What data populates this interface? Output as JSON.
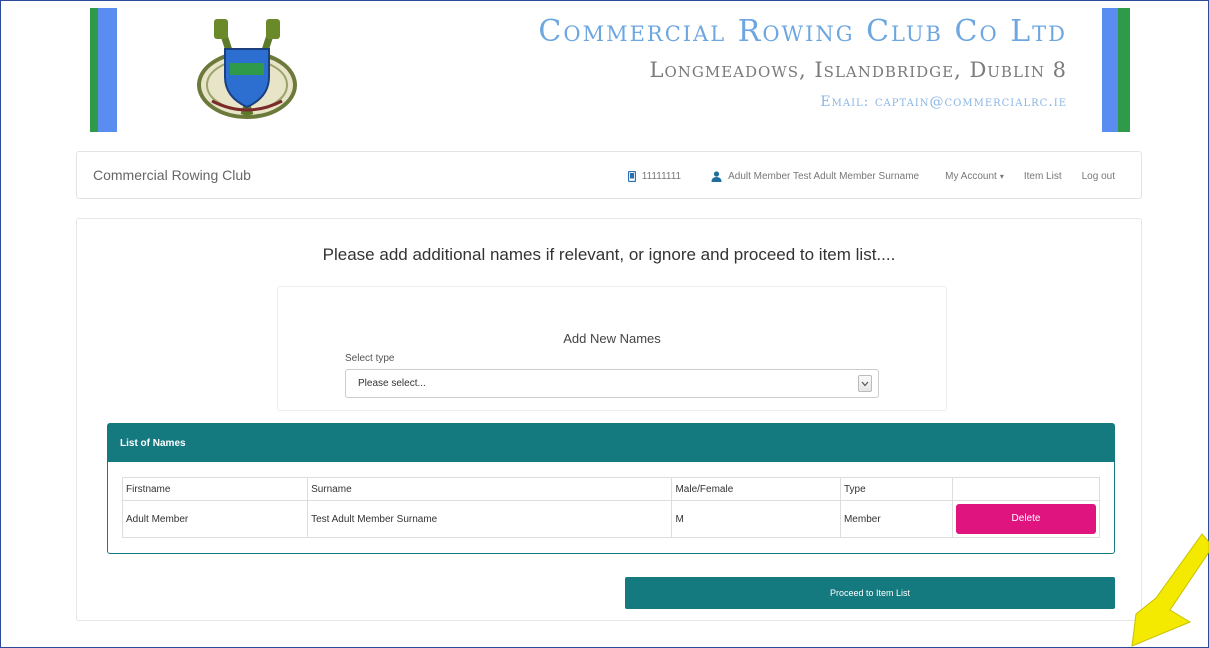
{
  "colors": {
    "teal": "#157a80",
    "magenta": "#e0147f",
    "green_stripe": "#2e9a4a",
    "blue_stripe": "#5b8df0",
    "title_blue": "#6ea7e0",
    "arrow_yellow": "#f4ea00"
  },
  "header": {
    "title": "Commercial Rowing Club Co Ltd",
    "address": "Longmeadows, Islandbridge, Dublin 8",
    "email": "Email: captain@commercialrc.ie",
    "logo_icon": "club-crest-with-oars"
  },
  "navbar": {
    "brand": "Commercial Rowing Club",
    "phone_icon": "mobile-phone-icon",
    "phone": "11111111",
    "user_icon": "user-icon",
    "user_name": "Adult Member Test Adult Member Surname",
    "my_account": "My Account",
    "item_list": "Item List",
    "logout": "Log out"
  },
  "main": {
    "intro": "Please add additional names if relevant, or ignore and proceed to item list....",
    "add_names": {
      "title": "Add New Names",
      "select_label": "Select type",
      "select_value": "Please select..."
    },
    "list": {
      "header": "List of Names",
      "columns": [
        "Firstname",
        "Surname",
        "Male/Female",
        "Type",
        ""
      ],
      "rows": [
        {
          "firstname": "Adult Member",
          "surname": "Test Adult Member Surname",
          "gender": "M",
          "type": "Member",
          "action": "Delete"
        }
      ]
    },
    "proceed_label": "Proceed to Item List"
  }
}
